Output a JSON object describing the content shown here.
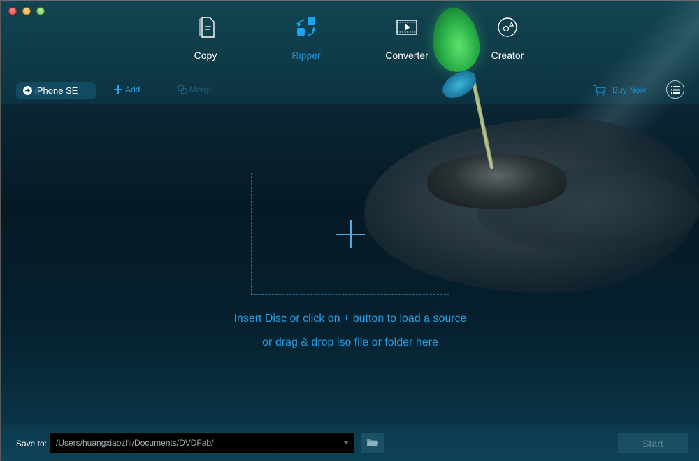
{
  "window": {
    "traffic_lights": [
      "close",
      "minimize",
      "zoom"
    ]
  },
  "nav": {
    "items": [
      {
        "label": "Copy",
        "icon": "copy-icon",
        "active": false
      },
      {
        "label": "Ripper",
        "icon": "ripper-icon",
        "active": true
      },
      {
        "label": "Converter",
        "icon": "converter-icon",
        "active": false
      },
      {
        "label": "Creator",
        "icon": "creator-icon",
        "active": false
      }
    ]
  },
  "toolbar": {
    "profile_label": "iPhone SE",
    "add_label": "Add",
    "merge_label": "Merge",
    "buy_label": "Buy Now",
    "menu_icon": "list-icon"
  },
  "main": {
    "hint_line1": "Insert Disc or click on + button to load a source",
    "hint_line2": "or drag & drop iso file or folder here"
  },
  "bottom": {
    "save_to_label": "Save to:",
    "path_value": "/Users/huangxiaozhi/Documents/DVDFab/",
    "start_label": "Start"
  },
  "colors": {
    "accent": "#1e8fd0",
    "hint_text": "#2a9ee4",
    "background": "#061a25"
  }
}
